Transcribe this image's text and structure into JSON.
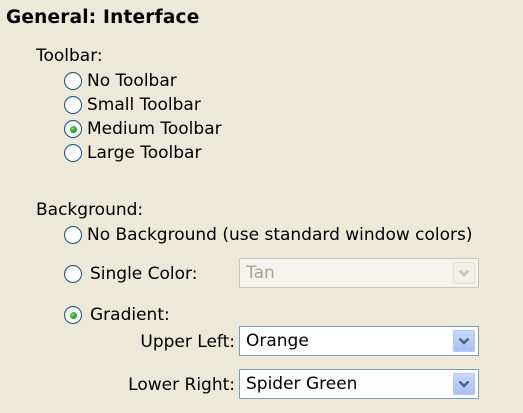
{
  "section_title": "General: Interface",
  "toolbar": {
    "label": "Toolbar:",
    "options": [
      {
        "label": "No Toolbar",
        "selected": false
      },
      {
        "label": "Small Toolbar",
        "selected": false
      },
      {
        "label": "Medium Toolbar",
        "selected": true
      },
      {
        "label": "Large Toolbar",
        "selected": false
      }
    ]
  },
  "background": {
    "label": "Background:",
    "no_background_label": "No Background (use standard window colors)",
    "single_color_label": "Single Color:",
    "single_color_value": "Tan",
    "single_color_enabled": false,
    "gradient_label": "Gradient:",
    "selected": "gradient",
    "upper_left_label": "Upper Left:",
    "upper_left_value": "Orange",
    "lower_right_label": "Lower Right:",
    "lower_right_value": "Spider Green"
  },
  "colors": {
    "panel_background": "#ece9d8",
    "radio_selected": "#21a121",
    "radio_border": "#1c5180",
    "combo_border": "#7f9db9",
    "disabled_text": "#a3a196"
  }
}
